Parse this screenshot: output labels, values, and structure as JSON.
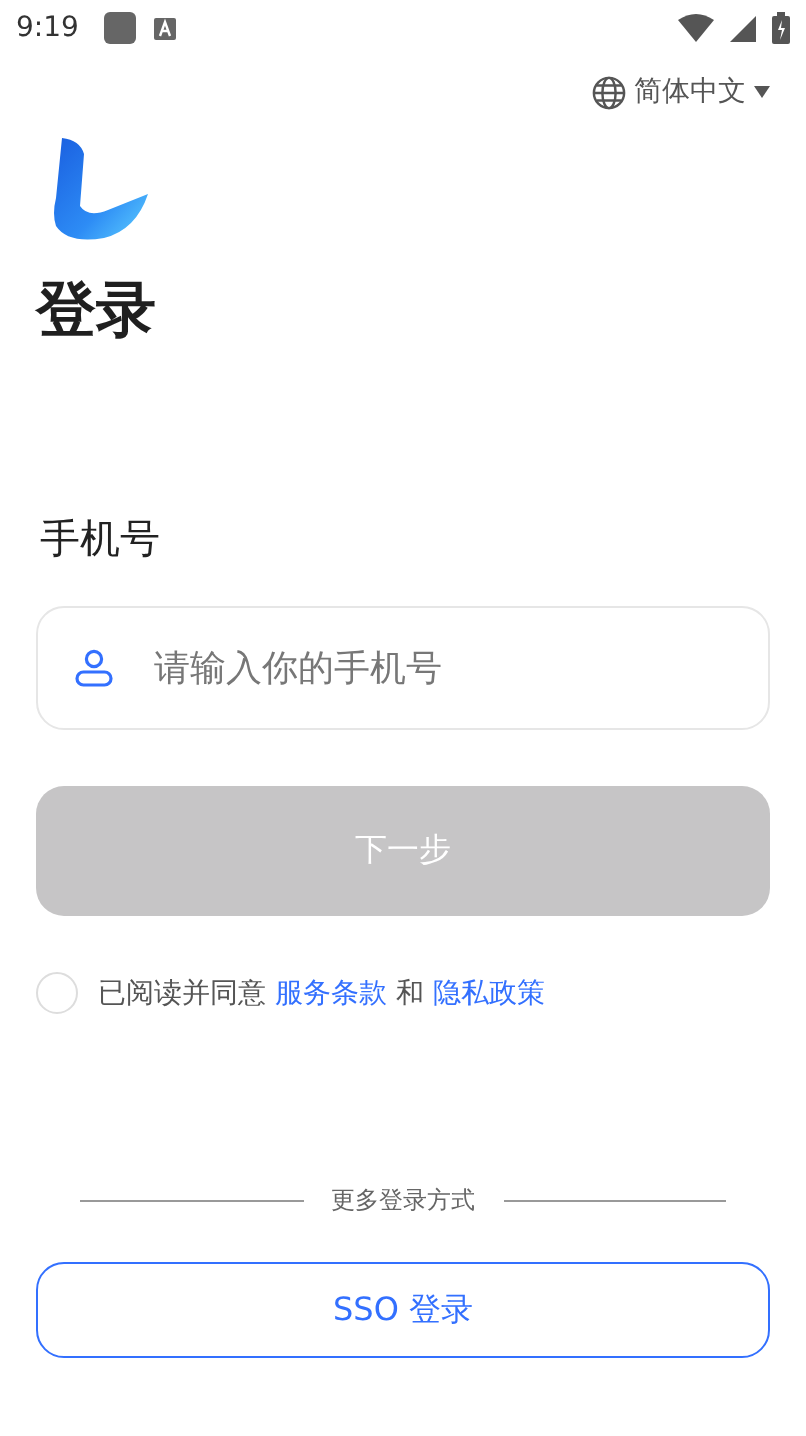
{
  "status_bar": {
    "time": "9:19"
  },
  "language": {
    "label": "简体中文"
  },
  "title": "登录",
  "phone": {
    "label": "手机号",
    "placeholder": "请输入你的手机号"
  },
  "next_button": {
    "label": "下一步",
    "disabled": true
  },
  "agreement": {
    "checked": false,
    "parts": [
      {
        "kind": "text",
        "text": "已阅读并同意"
      },
      {
        "kind": "link",
        "text": "服务条款"
      },
      {
        "kind": "text",
        "text": "和"
      },
      {
        "kind": "link",
        "text": "隐私政策"
      }
    ]
  },
  "divider_label": "更多登录方式",
  "sso_button": {
    "label": "SSO 登录"
  }
}
